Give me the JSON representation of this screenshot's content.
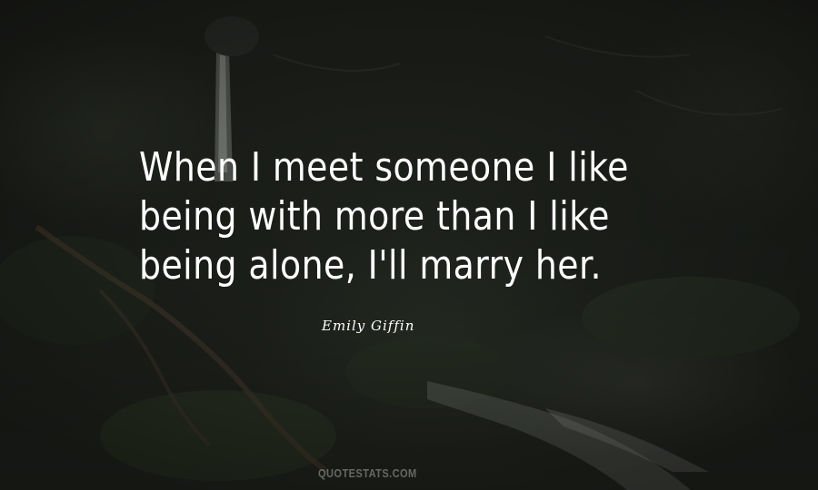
{
  "quote": {
    "lines": [
      "When I meet someone I like",
      "being with more than I like",
      "being alone, I'll marry her."
    ],
    "author": "Emily Giffin"
  },
  "watermark": "QUOTESTATS.COM",
  "colors": {
    "background": "#1f231d",
    "text": "#ffffff",
    "watermark": "#c8c8c8"
  }
}
